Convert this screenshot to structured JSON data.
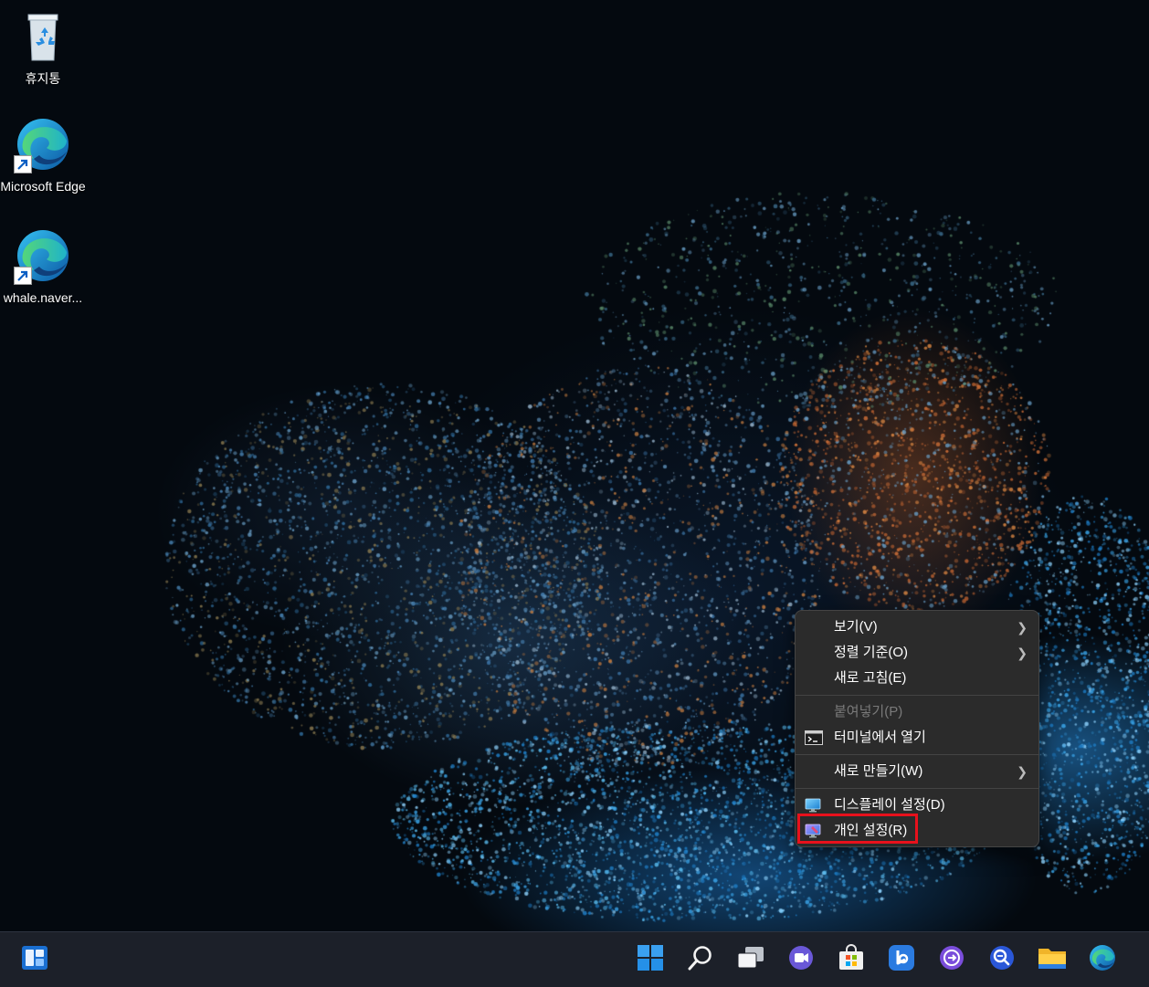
{
  "desktop": {
    "icons": [
      {
        "label": "휴지통"
      },
      {
        "label": "Microsoft Edge"
      },
      {
        "label": "whale.naver..."
      }
    ]
  },
  "context_menu": {
    "items": [
      {
        "label": "보기(V)",
        "has_submenu": true,
        "disabled": false
      },
      {
        "label": "정렬 기준(O)",
        "has_submenu": true,
        "disabled": false
      },
      {
        "label": "새로 고침(E)",
        "has_submenu": false,
        "disabled": false
      },
      {
        "label": "붙여넣기(P)",
        "has_submenu": false,
        "disabled": true
      },
      {
        "label": "터미널에서 열기",
        "icon": "terminal-icon",
        "has_submenu": false,
        "disabled": false
      },
      {
        "label": "새로 만들기(W)",
        "has_submenu": true,
        "disabled": false
      },
      {
        "label": "디스플레이 설정(D)",
        "icon": "display-settings-icon",
        "has_submenu": false,
        "disabled": false
      },
      {
        "label": "개인 설정(R)",
        "icon": "personalize-icon",
        "has_submenu": false,
        "disabled": false,
        "highlighted": true
      }
    ],
    "highlight_color": "#e8111c"
  },
  "taskbar": {
    "icons": [
      "widgets-icon",
      "start-icon",
      "search-icon",
      "task-view-icon",
      "chat-icon",
      "microsoft-store-icon",
      "bing-icon",
      "copilot-icon",
      "app-icon",
      "file-explorer-icon",
      "edge-icon"
    ]
  }
}
